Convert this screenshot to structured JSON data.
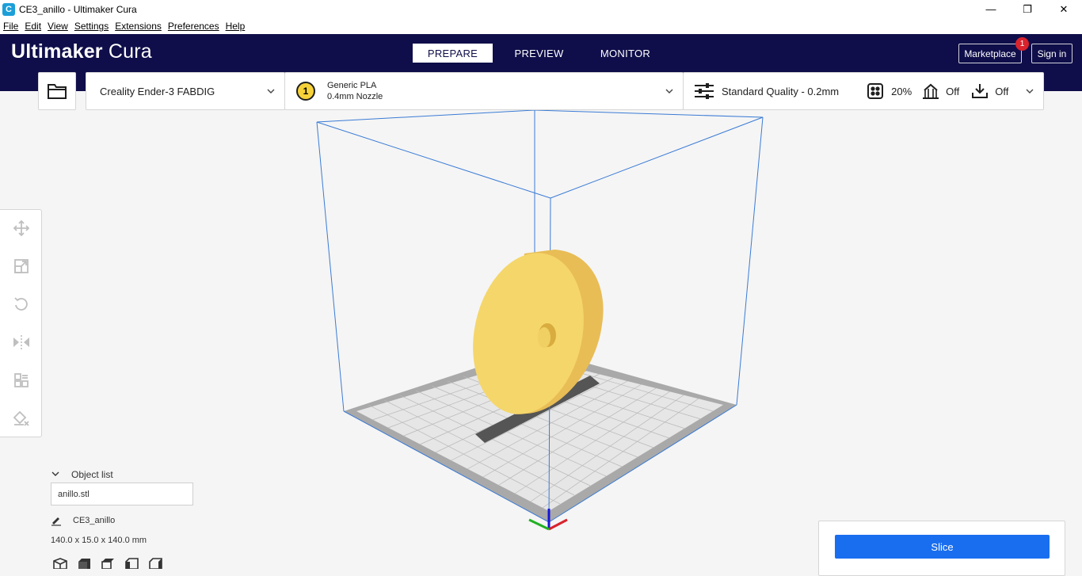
{
  "window": {
    "title": "CE3_anillo - Ultimaker Cura",
    "minimize": "—",
    "restore": "❐",
    "close": "✕"
  },
  "menu": [
    "File",
    "Edit",
    "View",
    "Settings",
    "Extensions",
    "Preferences",
    "Help"
  ],
  "header": {
    "logo_bold": "Ultimaker",
    "logo_light": "Cura",
    "tabs": [
      "PREPARE",
      "PREVIEW",
      "MONITOR"
    ],
    "active_tab": "PREPARE",
    "marketplace": "Marketplace",
    "marketplace_badge": "1",
    "signin": "Sign in"
  },
  "toolbar": {
    "printer": "Creality Ender-3 FABDIG",
    "extruder_number": "1",
    "material": "Generic PLA",
    "nozzle": "0.4mm Nozzle",
    "quality": "Standard Quality - 0.2mm",
    "infill": "20%",
    "support": "Off",
    "adhesion": "Off"
  },
  "colors": {
    "header_bg": "#0f0e4a",
    "accent_blue": "#196ef0",
    "model_yellow": "#f5d66b",
    "badge_red": "#d9232d"
  },
  "object_list": {
    "header": "Object list",
    "item": "anillo.stl",
    "job_name": "CE3_anillo",
    "dimensions": "140.0 x 15.0 x 140.0 mm"
  },
  "slice": {
    "label": "Slice"
  }
}
